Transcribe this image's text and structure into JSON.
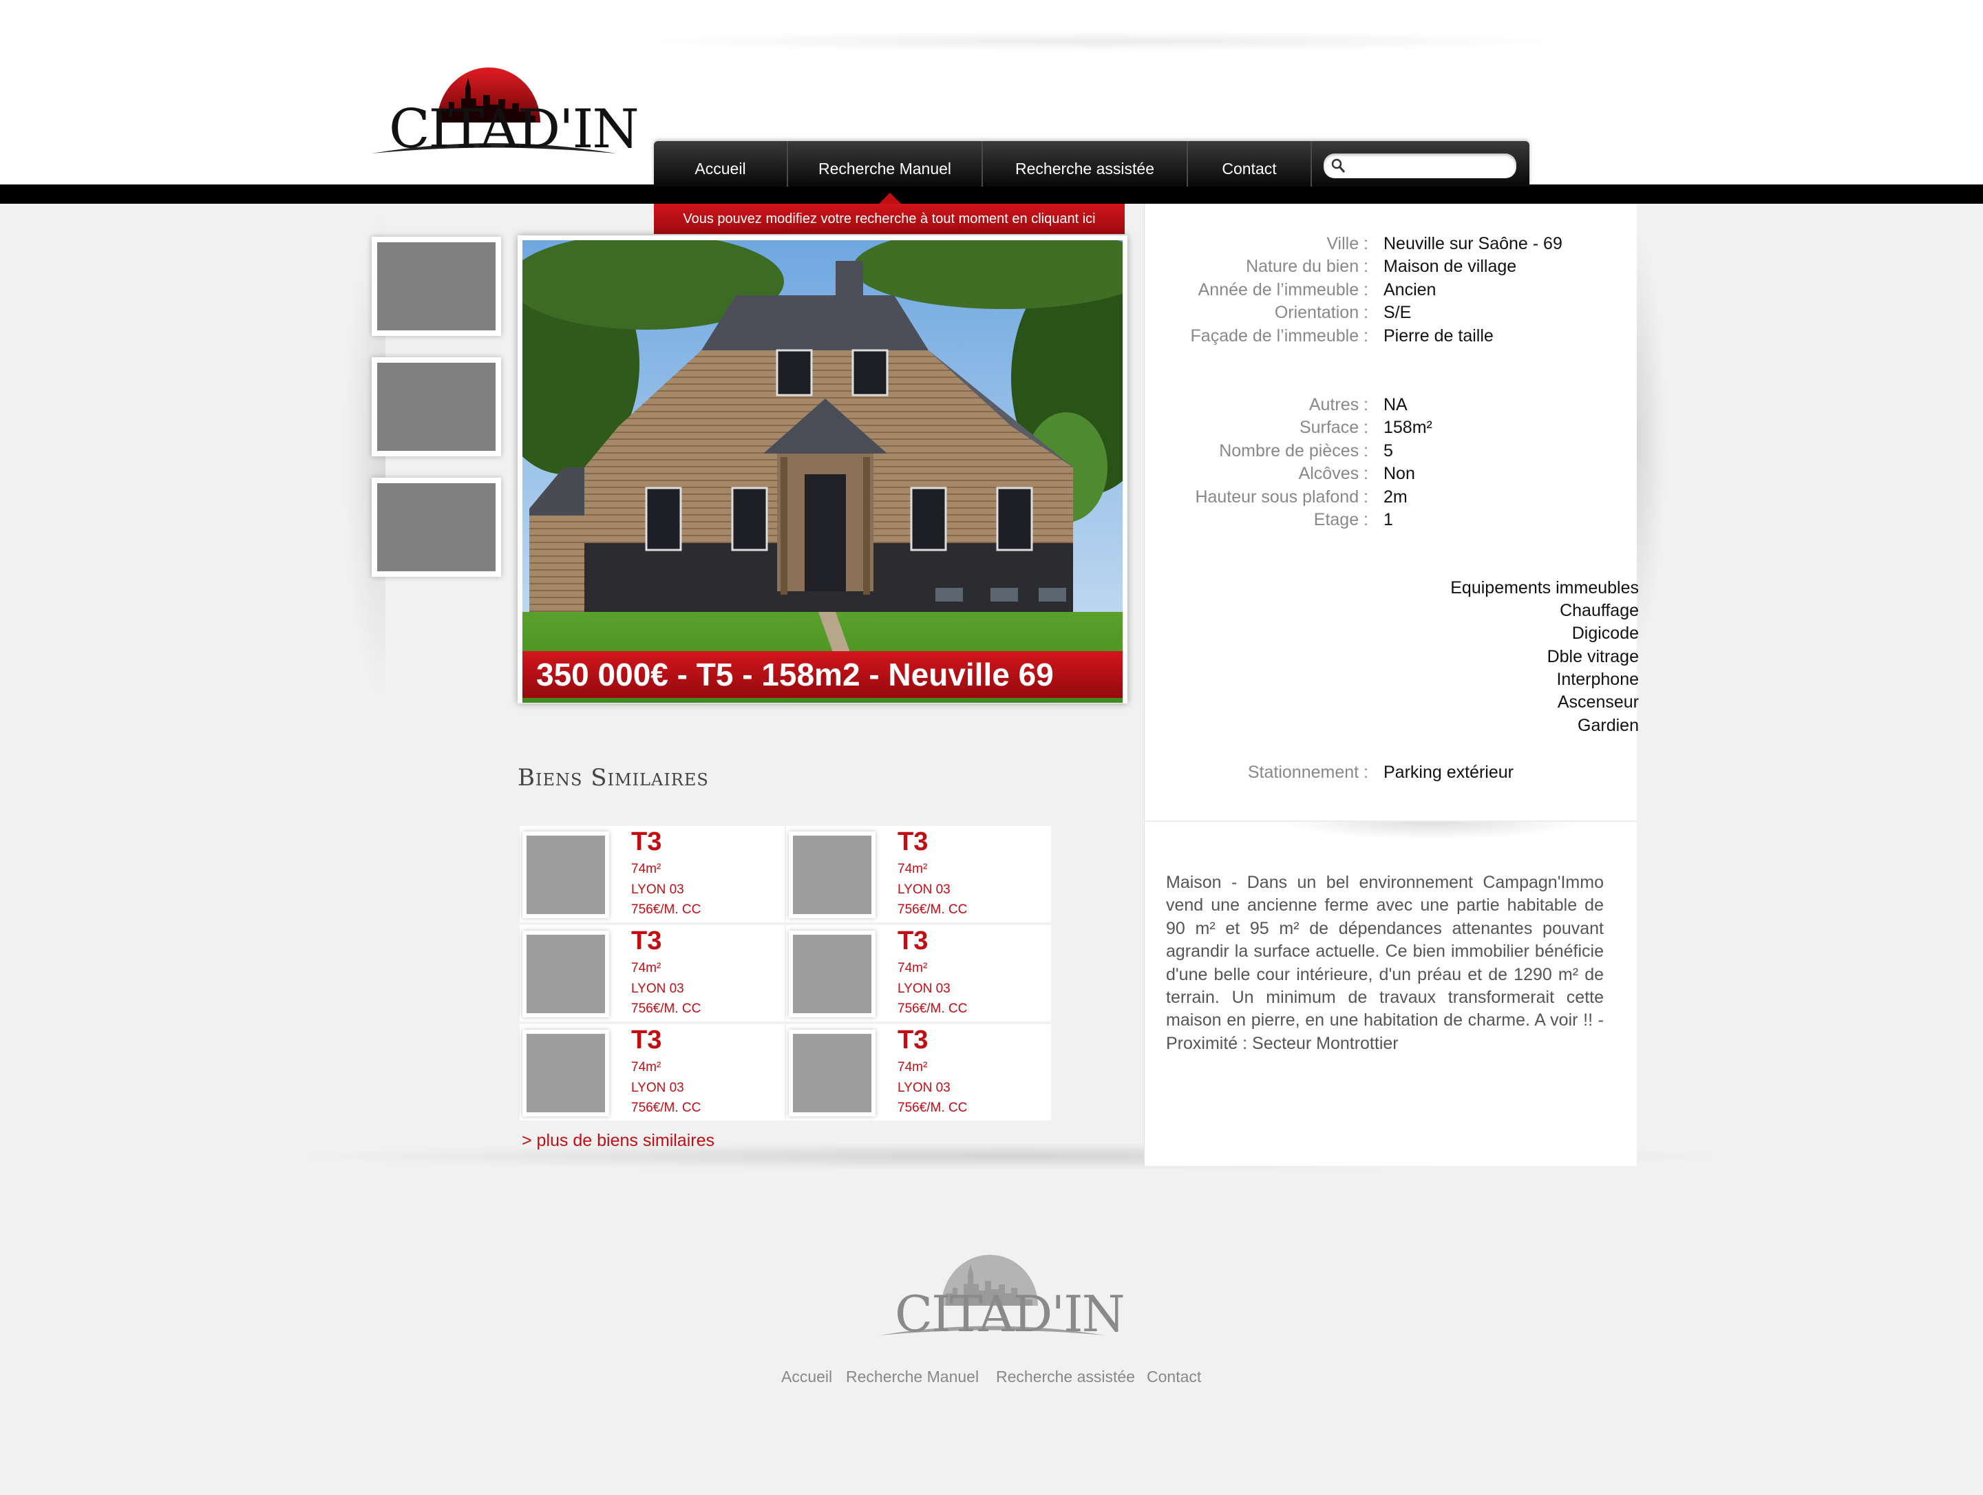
{
  "brand": {
    "name": "CITAD'IN",
    "accent": "#c30d13",
    "header_dark": "#0a0a0a"
  },
  "nav": {
    "items": [
      {
        "label": "Accueil"
      },
      {
        "label": "Recherche Manuel"
      },
      {
        "label": "Recherche assistée"
      },
      {
        "label": "Contact"
      }
    ],
    "search": {
      "placeholder": "",
      "icon": "search-icon"
    },
    "notice": "Vous pouvez modifiez votre recherche à tout moment en cliquant ici"
  },
  "listing": {
    "headline": "350 000€ - T5 - 158m2 - Neuville 69",
    "details_1": [
      {
        "key": "Ville :",
        "value": "Neuville sur Saône - 69"
      },
      {
        "key": "Nature du bien :",
        "value": "Maison de village"
      },
      {
        "key": "Année de l’immeuble :",
        "value": "Ancien"
      },
      {
        "key": "Orientation :",
        "value": "S/E"
      },
      {
        "key": "Façade de l’immeuble :",
        "value": "Pierre de taille"
      }
    ],
    "details_2": [
      {
        "key": "Autres :",
        "value": "NA"
      },
      {
        "key": "Surface :",
        "value": "158m²"
      },
      {
        "key": "Nombre de pièces :",
        "value": "5"
      },
      {
        "key": "Alcôves :",
        "value": "Non"
      },
      {
        "key": "Hauteur sous plafond :",
        "value": "2m"
      },
      {
        "key": "Etage :",
        "value": "1"
      }
    ],
    "equipements": [
      "Equipements immeubles",
      "Chauffage",
      "Digicode",
      "Dble vitrage",
      "Interphone",
      "Ascenseur",
      "Gardien"
    ],
    "stationnement": {
      "key": "Stationnement :",
      "value": "Parking extérieur"
    },
    "description": "Maison - Dans un bel environnement Campagn'Immo vend une ancienne ferme avec une partie habitable de 90 m² et 95 m² de dépendances attenantes pouvant agrandir la surface actuelle. Ce bien immobilier bénéficie d'une belle cour intérieure, d'un préau et de 1290 m² de terrain. Un minimum de travaux transformerait cette maison en pierre, en une habitation de charme. A voir !! - Proximité : Secteur Montrottier"
  },
  "similar": {
    "title": "Biens Similaires",
    "items": [
      {
        "type": "T3",
        "surface": "74m²",
        "city": "LYON 03",
        "price": "756€/M. CC"
      },
      {
        "type": "T3",
        "surface": "74m²",
        "city": "LYON 03",
        "price": "756€/M. CC"
      },
      {
        "type": "T3",
        "surface": "74m²",
        "city": "LYON 03",
        "price": "756€/M. CC"
      },
      {
        "type": "T3",
        "surface": "74m²",
        "city": "LYON 03",
        "price": "756€/M. CC"
      },
      {
        "type": "T3",
        "surface": "74m²",
        "city": "LYON 03",
        "price": "756€/M. CC"
      },
      {
        "type": "T3",
        "surface": "74m²",
        "city": "LYON 03",
        "price": "756€/M. CC"
      }
    ],
    "more_link": "> plus de biens similaires"
  },
  "footer": {
    "links": [
      "Accueil",
      "Recherche Manuel",
      "Recherche assistée",
      "Contact"
    ]
  }
}
